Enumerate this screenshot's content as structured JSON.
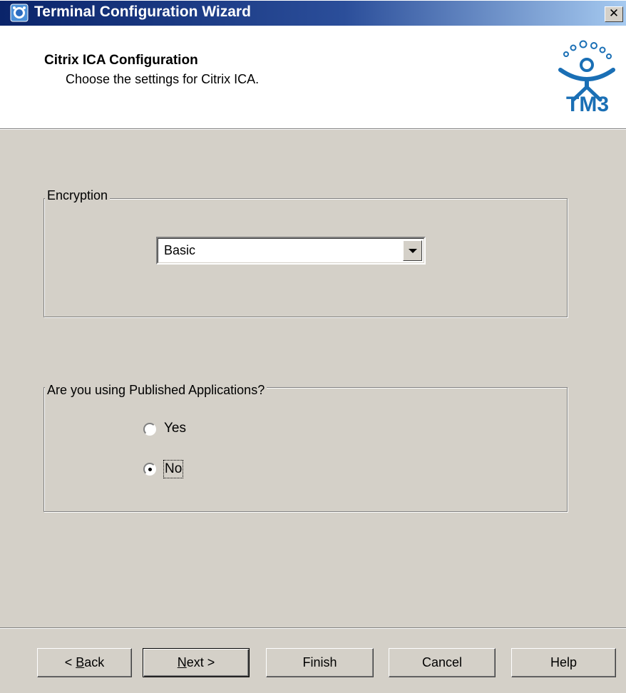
{
  "window": {
    "title": "Terminal Configuration Wizard",
    "close_glyph": "✕"
  },
  "header": {
    "title": "Citrix ICA Configuration",
    "subtitle": "Choose the settings for Citrix ICA.",
    "logo_text": "TM3",
    "logo_icon": "tm3-person-logo"
  },
  "encryption": {
    "legend": "Encryption",
    "selected": "Basic"
  },
  "published_apps": {
    "legend": "Are you using Published Applications?",
    "options": [
      {
        "label": "Yes",
        "checked": false
      },
      {
        "label": "No",
        "checked": true
      }
    ]
  },
  "buttons": {
    "back_pre": "< ",
    "back_acc": "B",
    "back_post": "ack",
    "next_acc": "N",
    "next_post": "ext >",
    "finish": "Finish",
    "cancel": "Cancel",
    "help": "Help"
  },
  "colors": {
    "titlebar_start": "#0a246a",
    "titlebar_end": "#a6caf0",
    "face": "#d4d0c8",
    "logo_blue": "#1a6fb5"
  }
}
